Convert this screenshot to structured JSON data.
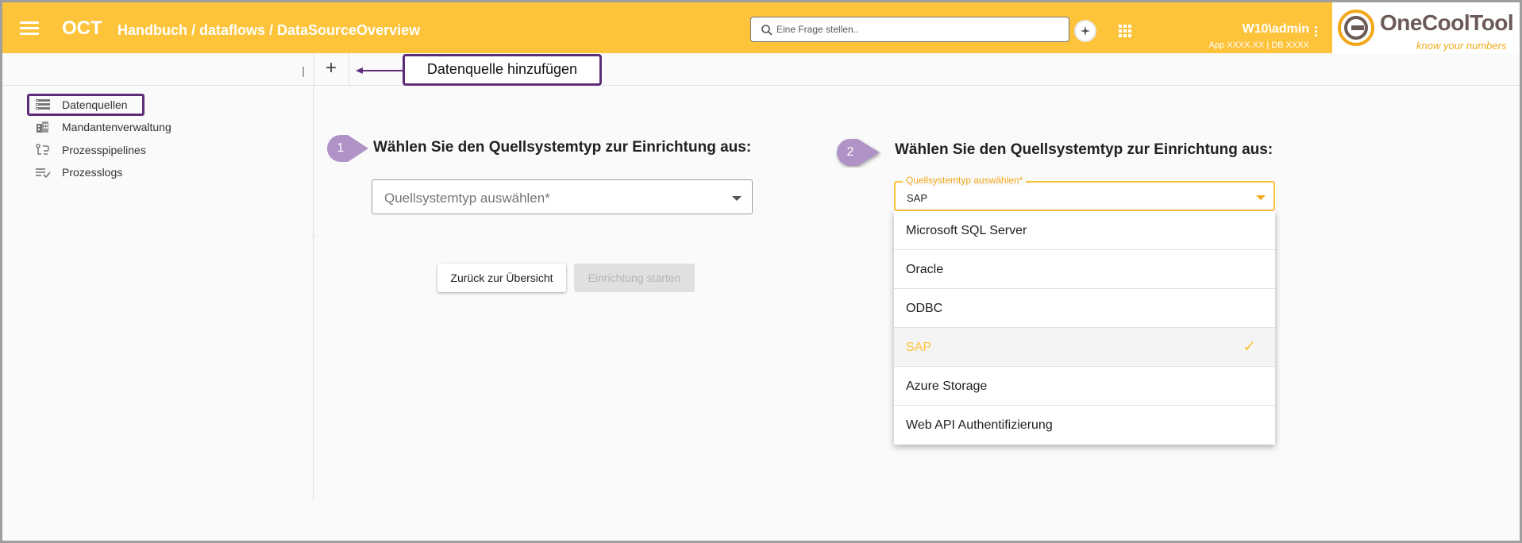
{
  "header": {
    "app_name": "OCT",
    "breadcrumb": "Handbuch / dataflows / DataSourceOverview",
    "search_placeholder": "Eine Frage stellen..",
    "user": "W10\\admin",
    "user_sub": "App XXXX.XX | DB XXXX",
    "logo_name": "OneCoolTool",
    "logo_tagline": "know your numbers",
    "icons": [
      "menu-icon",
      "search-icon",
      "ai-sparkle-icon",
      "apps-grid-icon",
      "more-vert-icon"
    ]
  },
  "toolbar": {
    "add_label": "+",
    "callout": "Datenquelle hinzufügen"
  },
  "sidebar": {
    "items": [
      {
        "label": "Datenquellen",
        "icon": "storage-icon",
        "active": true
      },
      {
        "label": "Mandantenverwaltung",
        "icon": "building-icon",
        "active": false
      },
      {
        "label": "Prozesspipelines",
        "icon": "pipeline-icon",
        "active": false
      },
      {
        "label": "Prozesslogs",
        "icon": "list-check-icon",
        "active": false
      }
    ]
  },
  "step1": {
    "badge": "1",
    "heading": "Wählen Sie den Quellsystemtyp zur Einrichtung aus:",
    "select_placeholder": "Quellsystemtyp auswählen*",
    "back_button": "Zurück zur Übersicht",
    "start_button": "Einrichtung starten"
  },
  "step2": {
    "badge": "2",
    "heading": "Wählen Sie den Quellsystemtyp zur Einrichtung aus:",
    "select_label": "Quellsystemtyp auswählen*",
    "select_value": "SAP",
    "options": [
      {
        "label": "Microsoft SQL Server",
        "selected": false
      },
      {
        "label": "Oracle",
        "selected": false
      },
      {
        "label": "ODBC",
        "selected": false
      },
      {
        "label": "SAP",
        "selected": true
      },
      {
        "label": "Azure Storage",
        "selected": false
      },
      {
        "label": "Web API Authentifizierung",
        "selected": false
      }
    ]
  },
  "colors": {
    "brand": "#fdc33a",
    "annotation": "#5e2d79",
    "badge": "#b093c6"
  }
}
